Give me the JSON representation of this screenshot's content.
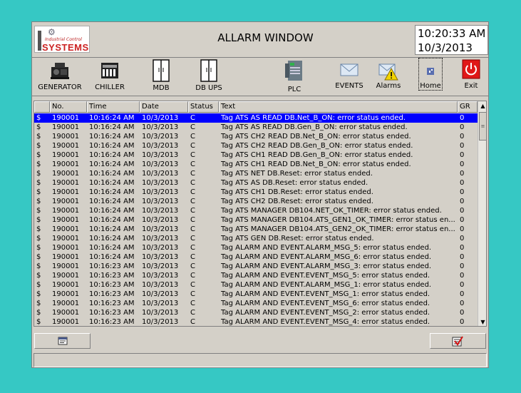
{
  "header": {
    "logo_sub": "Industrial Control",
    "logo_main": "SYSTEMS",
    "title": "ALLARM WINDOW",
    "time": "10:20:33 AM",
    "date": "10/3/2013"
  },
  "nav": [
    {
      "label": "GENERATOR",
      "icon": "generator-icon"
    },
    {
      "label": "CHILLER",
      "icon": "chiller-icon"
    },
    {
      "label": "MDB",
      "icon": "cabinet-icon"
    },
    {
      "label": "DB UPS",
      "icon": "cabinet-icon"
    },
    {
      "label": "PLC",
      "icon": "plc-icon"
    },
    {
      "label": "EVENTS",
      "icon": "envelope-icon"
    },
    {
      "label": "Alarms",
      "icon": "alarm-envelope-icon"
    },
    {
      "label": "Home",
      "icon": "home-icon"
    },
    {
      "label": "Exit",
      "icon": "power-icon"
    }
  ],
  "table": {
    "columns": [
      "",
      "No.",
      "Time",
      "Date",
      "Status",
      "Text",
      "GR"
    ],
    "rows": [
      [
        "$",
        "190001",
        "10:16:24 AM",
        "10/3/2013",
        "C",
        "Tag ATS AS READ DB.Net_B_ON: error status ended.",
        "0"
      ],
      [
        "$",
        "190001",
        "10:16:24 AM",
        "10/3/2013",
        "C",
        "Tag ATS AS READ DB.Gen_B_ON: error status ended.",
        "0"
      ],
      [
        "$",
        "190001",
        "10:16:24 AM",
        "10/3/2013",
        "C",
        "Tag ATS CH2 READ DB.Net_B_ON: error status ended.",
        "0"
      ],
      [
        "$",
        "190001",
        "10:16:24 AM",
        "10/3/2013",
        "C",
        "Tag ATS CH2 READ DB.Gen_B_ON: error status ended.",
        "0"
      ],
      [
        "$",
        "190001",
        "10:16:24 AM",
        "10/3/2013",
        "C",
        "Tag ATS CH1 READ DB.Gen_B_ON: error status ended.",
        "0"
      ],
      [
        "$",
        "190001",
        "10:16:24 AM",
        "10/3/2013",
        "C",
        "Tag ATS CH1 READ DB.Net_B_ON: error status ended.",
        "0"
      ],
      [
        "$",
        "190001",
        "10:16:24 AM",
        "10/3/2013",
        "C",
        "Tag ATS NET DB.Reset: error status ended.",
        "0"
      ],
      [
        "$",
        "190001",
        "10:16:24 AM",
        "10/3/2013",
        "C",
        "Tag ATS AS DB.Reset: error status ended.",
        "0"
      ],
      [
        "$",
        "190001",
        "10:16:24 AM",
        "10/3/2013",
        "C",
        "Tag ATS CH1 DB.Reset: error status ended.",
        "0"
      ],
      [
        "$",
        "190001",
        "10:16:24 AM",
        "10/3/2013",
        "C",
        "Tag ATS CH2 DB.Reset: error status ended.",
        "0"
      ],
      [
        "$",
        "190001",
        "10:16:24 AM",
        "10/3/2013",
        "C",
        "Tag ATS MANAGER DB104.NET_OK_TIMER: error status ended.",
        "0"
      ],
      [
        "$",
        "190001",
        "10:16:24 AM",
        "10/3/2013",
        "C",
        "Tag ATS MANAGER DB104.ATS_GEN1_OK_TIMER: error status en...",
        "0"
      ],
      [
        "$",
        "190001",
        "10:16:24 AM",
        "10/3/2013",
        "C",
        "Tag ATS MANAGER DB104.ATS_GEN2_OK_TIMER: error status en...",
        "0"
      ],
      [
        "$",
        "190001",
        "10:16:24 AM",
        "10/3/2013",
        "C",
        "Tag ATS GEN DB.Reset: error status ended.",
        "0"
      ],
      [
        "$",
        "190001",
        "10:16:24 AM",
        "10/3/2013",
        "C",
        "Tag ALARM AND EVENT.ALARM_MSG_5: error status ended.",
        "0"
      ],
      [
        "$",
        "190001",
        "10:16:24 AM",
        "10/3/2013",
        "C",
        "Tag ALARM AND EVENT.ALARM_MSG_6: error status ended.",
        "0"
      ],
      [
        "$",
        "190001",
        "10:16:23 AM",
        "10/3/2013",
        "C",
        "Tag ALARM AND EVENT.ALARM_MSG_3: error status ended.",
        "0"
      ],
      [
        "$",
        "190001",
        "10:16:23 AM",
        "10/3/2013",
        "C",
        "Tag ALARM AND EVENT.EVENT_MSG_5: error status ended.",
        "0"
      ],
      [
        "$",
        "190001",
        "10:16:23 AM",
        "10/3/2013",
        "C",
        "Tag ALARM AND EVENT.ALARM_MSG_1: error status ended.",
        "0"
      ],
      [
        "$",
        "190001",
        "10:16:23 AM",
        "10/3/2013",
        "C",
        "Tag ALARM AND EVENT.EVENT_MSG_1: error status ended.",
        "0"
      ],
      [
        "$",
        "190001",
        "10:16:23 AM",
        "10/3/2013",
        "C",
        "Tag ALARM AND EVENT.EVENT_MSG_6: error status ended.",
        "0"
      ],
      [
        "$",
        "190001",
        "10:16:23 AM",
        "10/3/2013",
        "C",
        "Tag ALARM AND EVENT.EVENT_MSG_2: error status ended.",
        "0"
      ],
      [
        "$",
        "190001",
        "10:16:23 AM",
        "10/3/2013",
        "C",
        "Tag ALARM AND EVENT.EVENT_MSG_4: error status ended.",
        "0"
      ]
    ],
    "selected_row": 0
  },
  "colors": {
    "background": "#36c8c4",
    "panel": "#d4d0c8",
    "selection": "#0000ff"
  }
}
